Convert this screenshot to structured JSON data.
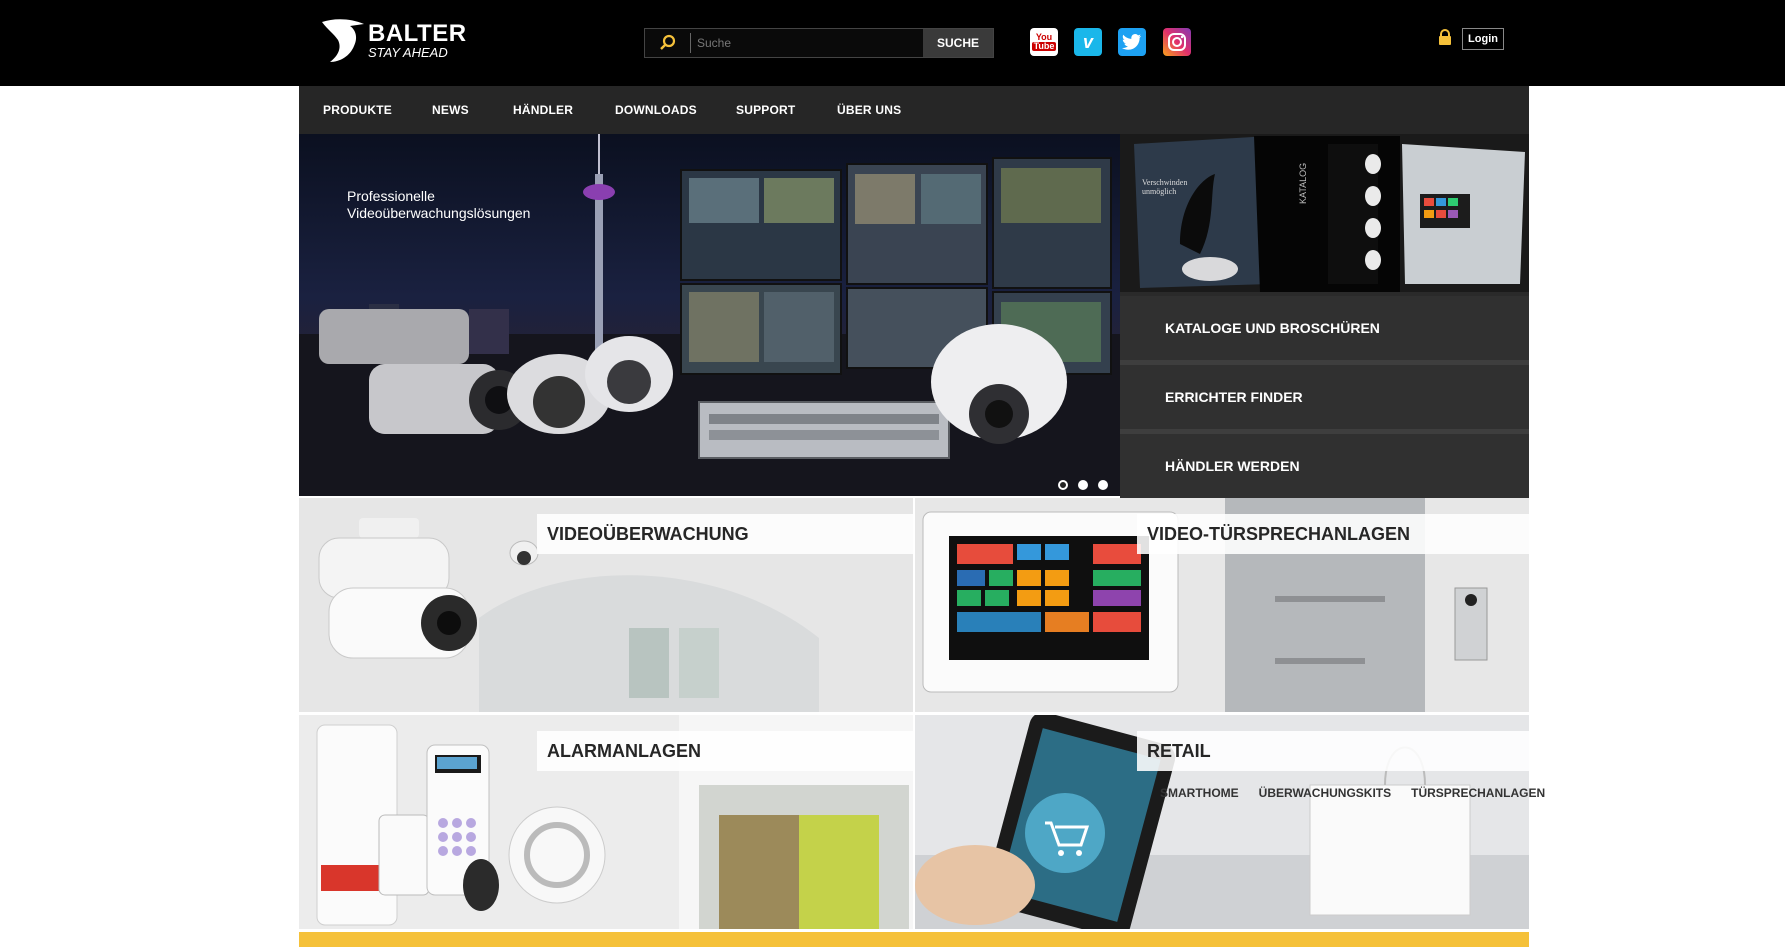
{
  "header": {
    "brand": "BALTER",
    "tagline": "STAY AHEAD",
    "search_placeholder": "Suche",
    "search_button": "SUCHE",
    "social": {
      "youtube_top": "You",
      "youtube_bottom": "Tube",
      "vimeo": "v",
      "twitter": "twitter-icon",
      "instagram": "instagram-icon"
    },
    "login_label": "Login"
  },
  "nav": {
    "items": [
      "PRODUKTE",
      "NEWS",
      "HÄNDLER",
      "DOWNLOADS",
      "SUPPORT",
      "ÜBER UNS"
    ]
  },
  "hero": {
    "caption_line1": "Professionelle",
    "caption_line2": "Videoüberwachungslösungen",
    "slide_count": 3,
    "active_slide": 1
  },
  "side_panel": {
    "thumb_text_1": "Verschwinden unmöglich",
    "thumb_text_2": "KATALOG",
    "links": [
      "KATALOGE UND BROSCHÜREN",
      "ERRICHTER FINDER",
      "HÄNDLER WERDEN"
    ]
  },
  "tiles": {
    "video": "VIDEOÜBERWACHUNG",
    "door": "VIDEO-TÜRSPRECHANLAGEN",
    "alarm": "ALARMANLAGEN",
    "retail": "RETAIL",
    "retail_links": [
      "SMARTHOME",
      "ÜBERWACHUNGSKITS",
      "TÜRSPRECHANLAGEN"
    ]
  },
  "colors": {
    "header_bg": "#000000",
    "nav_bg": "#262626",
    "accent_yellow": "#f5c13a",
    "panel_bg": "#303030"
  }
}
